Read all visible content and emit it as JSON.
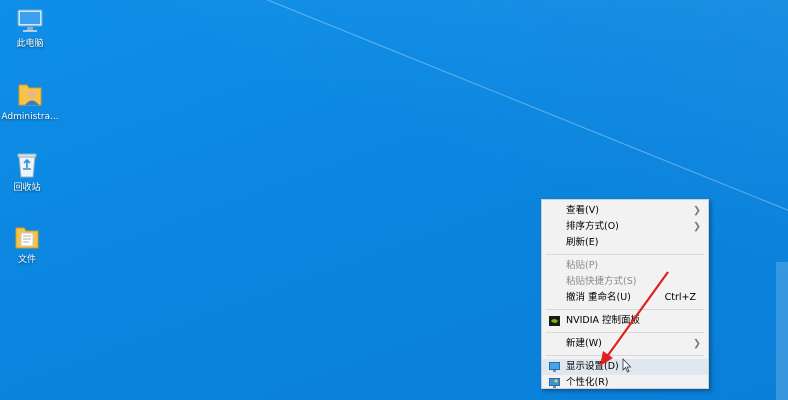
{
  "desktop": {
    "icons": [
      {
        "label": "此电脑",
        "icon": "computer-icon"
      },
      {
        "label": "Administra...",
        "icon": "user-folder-icon"
      },
      {
        "label": "回收站",
        "icon": "recycle-bin-icon"
      },
      {
        "label": "文件",
        "icon": "folder-icon"
      }
    ]
  },
  "context_menu": {
    "items": {
      "view": {
        "label": "查看(V)"
      },
      "sort": {
        "label": "排序方式(O)"
      },
      "refresh": {
        "label": "刷新(E)"
      },
      "paste": {
        "label": "粘贴(P)"
      },
      "paste_shortcut": {
        "label": "粘贴快捷方式(S)"
      },
      "undo": {
        "label": "撤消 重命名(U)",
        "shortcut": "Ctrl+Z"
      },
      "nvidia": {
        "label": "NVIDIA 控制面板"
      },
      "new": {
        "label": "新建(W)"
      },
      "display": {
        "label": "显示设置(D)"
      },
      "personalize": {
        "label": "个性化(R)"
      }
    }
  },
  "colors": {
    "desktop_bg": "#0b86e0",
    "annotation_arrow": "#e0201f",
    "nvidia_green": "#76b900"
  }
}
